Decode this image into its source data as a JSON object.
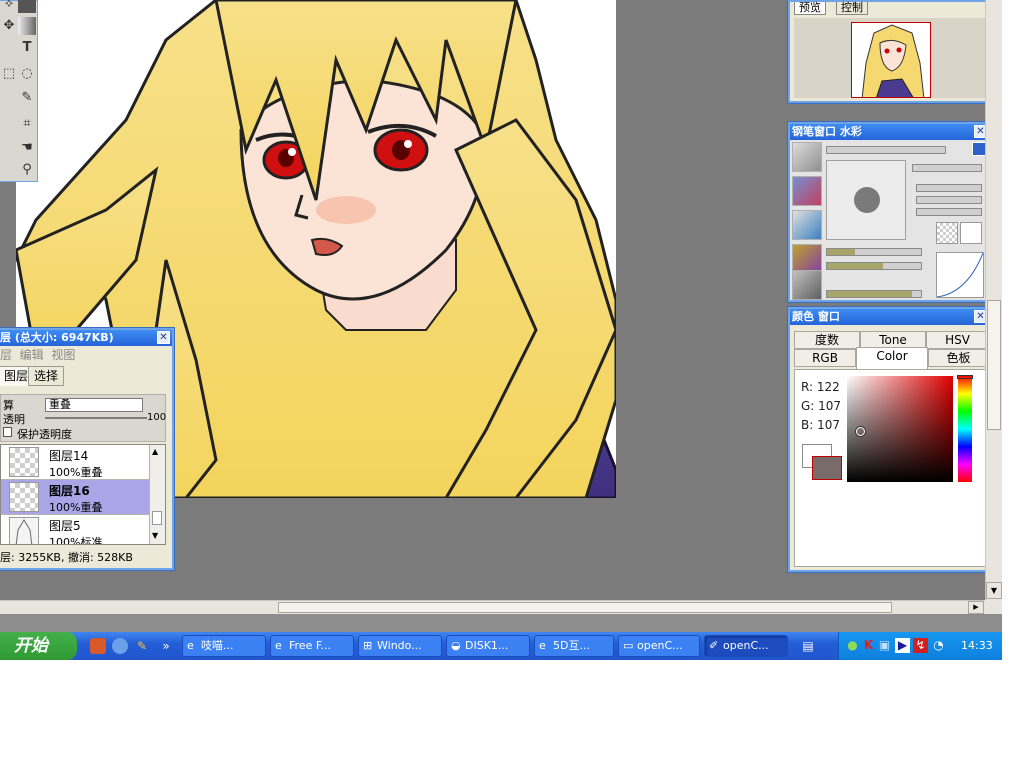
{
  "colors": {
    "workspace": "#7b7b7b",
    "title_bar": "#2564d8",
    "selected_layer": "#a9a6e7",
    "main_color": "#7a6b6b"
  },
  "tools": {
    "icons": [
      "lasso-icon",
      "rect-select-icon",
      "move-icon",
      "gradient-icon",
      "text-icon",
      "select-marquee-icon",
      "magic-wand-icon",
      "pen-icon",
      "crop-icon",
      "hand-icon",
      "zoom-icon"
    ],
    "text_tool_glyph": "T"
  },
  "preview": {
    "tabs": [
      "预览",
      "控制"
    ]
  },
  "brush_window": {
    "title": "钢笔窗口 水彩"
  },
  "color_window": {
    "title": "颜色 窗口",
    "tabs_row1": [
      "度数",
      "Tone",
      "HSV"
    ],
    "tabs_row2": [
      "RGB",
      "Color",
      "色板"
    ],
    "active_tab": "Color",
    "r": "R: 122",
    "g": "G: 107",
    "b": "B: 107"
  },
  "layers_window": {
    "title": "层 (总大小: 6947KB)",
    "menu": [
      "层",
      "编辑",
      "视图"
    ],
    "tabs": [
      "图层",
      "选择"
    ],
    "active_tab": "图层",
    "blend_label": "算",
    "blend_value": "重叠",
    "opacity_label": "透明",
    "opacity_value": "100",
    "preserve_label": "保护透明度",
    "layers": [
      {
        "name": "图层14",
        "mode": "100%重叠",
        "selected": false
      },
      {
        "name": "图层16",
        "mode": "100%重叠",
        "selected": true
      },
      {
        "name": "图层5",
        "mode": "100%标准",
        "selected": false
      }
    ],
    "status": "层: 3255KB, 撤消: 528KB"
  },
  "taskbar": {
    "start_label": "开始",
    "quick_launch": [
      "camera-icon",
      "globe-icon",
      "pencil-icon",
      "chevron-icon"
    ],
    "tasks": [
      {
        "label": "吱喵...",
        "icon": "ie-icon",
        "active": false
      },
      {
        "label": "Free F...",
        "icon": "ie-icon",
        "active": false
      },
      {
        "label": "Windo...",
        "icon": "windows-icon",
        "active": false
      },
      {
        "label": "DISK1...",
        "icon": "disk-icon",
        "active": false
      },
      {
        "label": "5D互...",
        "icon": "ie-icon",
        "active": false
      },
      {
        "label": "openC...",
        "icon": "folder-icon",
        "active": false
      },
      {
        "label": "openC...",
        "icon": "paint-icon",
        "active": true
      }
    ],
    "tray_icons": [
      "user-icon",
      "k-icon",
      "network-icon",
      "media-icon",
      "flashget-icon",
      "clock-small-icon"
    ],
    "clock": "14:33"
  }
}
